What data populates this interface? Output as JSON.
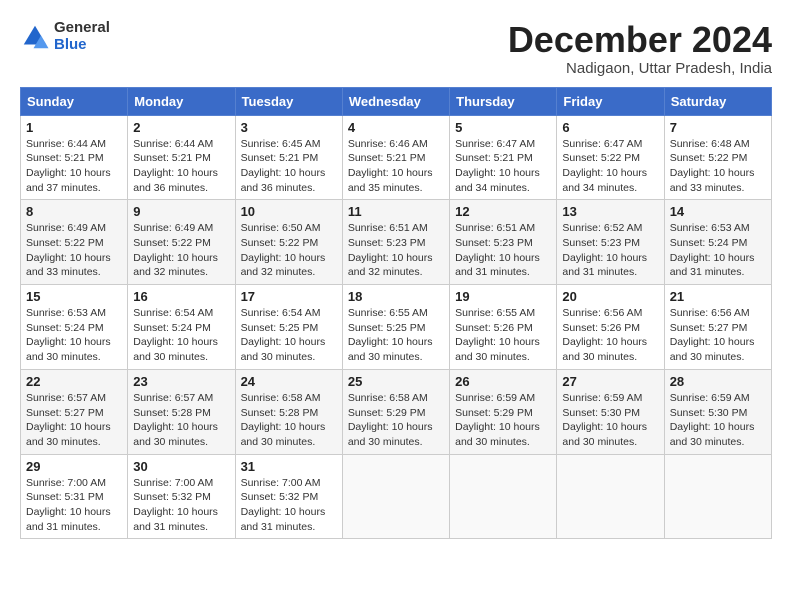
{
  "logo": {
    "general": "General",
    "blue": "Blue"
  },
  "title": "December 2024",
  "subtitle": "Nadigaon, Uttar Pradesh, India",
  "days_of_week": [
    "Sunday",
    "Monday",
    "Tuesday",
    "Wednesday",
    "Thursday",
    "Friday",
    "Saturday"
  ],
  "weeks": [
    [
      {
        "day": "1",
        "info": "Sunrise: 6:44 AM\nSunset: 5:21 PM\nDaylight: 10 hours\nand 37 minutes."
      },
      {
        "day": "2",
        "info": "Sunrise: 6:44 AM\nSunset: 5:21 PM\nDaylight: 10 hours\nand 36 minutes."
      },
      {
        "day": "3",
        "info": "Sunrise: 6:45 AM\nSunset: 5:21 PM\nDaylight: 10 hours\nand 36 minutes."
      },
      {
        "day": "4",
        "info": "Sunrise: 6:46 AM\nSunset: 5:21 PM\nDaylight: 10 hours\nand 35 minutes."
      },
      {
        "day": "5",
        "info": "Sunrise: 6:47 AM\nSunset: 5:21 PM\nDaylight: 10 hours\nand 34 minutes."
      },
      {
        "day": "6",
        "info": "Sunrise: 6:47 AM\nSunset: 5:22 PM\nDaylight: 10 hours\nand 34 minutes."
      },
      {
        "day": "7",
        "info": "Sunrise: 6:48 AM\nSunset: 5:22 PM\nDaylight: 10 hours\nand 33 minutes."
      }
    ],
    [
      {
        "day": "8",
        "info": "Sunrise: 6:49 AM\nSunset: 5:22 PM\nDaylight: 10 hours\nand 33 minutes."
      },
      {
        "day": "9",
        "info": "Sunrise: 6:49 AM\nSunset: 5:22 PM\nDaylight: 10 hours\nand 32 minutes."
      },
      {
        "day": "10",
        "info": "Sunrise: 6:50 AM\nSunset: 5:22 PM\nDaylight: 10 hours\nand 32 minutes."
      },
      {
        "day": "11",
        "info": "Sunrise: 6:51 AM\nSunset: 5:23 PM\nDaylight: 10 hours\nand 32 minutes."
      },
      {
        "day": "12",
        "info": "Sunrise: 6:51 AM\nSunset: 5:23 PM\nDaylight: 10 hours\nand 31 minutes."
      },
      {
        "day": "13",
        "info": "Sunrise: 6:52 AM\nSunset: 5:23 PM\nDaylight: 10 hours\nand 31 minutes."
      },
      {
        "day": "14",
        "info": "Sunrise: 6:53 AM\nSunset: 5:24 PM\nDaylight: 10 hours\nand 31 minutes."
      }
    ],
    [
      {
        "day": "15",
        "info": "Sunrise: 6:53 AM\nSunset: 5:24 PM\nDaylight: 10 hours\nand 30 minutes."
      },
      {
        "day": "16",
        "info": "Sunrise: 6:54 AM\nSunset: 5:24 PM\nDaylight: 10 hours\nand 30 minutes."
      },
      {
        "day": "17",
        "info": "Sunrise: 6:54 AM\nSunset: 5:25 PM\nDaylight: 10 hours\nand 30 minutes."
      },
      {
        "day": "18",
        "info": "Sunrise: 6:55 AM\nSunset: 5:25 PM\nDaylight: 10 hours\nand 30 minutes."
      },
      {
        "day": "19",
        "info": "Sunrise: 6:55 AM\nSunset: 5:26 PM\nDaylight: 10 hours\nand 30 minutes."
      },
      {
        "day": "20",
        "info": "Sunrise: 6:56 AM\nSunset: 5:26 PM\nDaylight: 10 hours\nand 30 minutes."
      },
      {
        "day": "21",
        "info": "Sunrise: 6:56 AM\nSunset: 5:27 PM\nDaylight: 10 hours\nand 30 minutes."
      }
    ],
    [
      {
        "day": "22",
        "info": "Sunrise: 6:57 AM\nSunset: 5:27 PM\nDaylight: 10 hours\nand 30 minutes."
      },
      {
        "day": "23",
        "info": "Sunrise: 6:57 AM\nSunset: 5:28 PM\nDaylight: 10 hours\nand 30 minutes."
      },
      {
        "day": "24",
        "info": "Sunrise: 6:58 AM\nSunset: 5:28 PM\nDaylight: 10 hours\nand 30 minutes."
      },
      {
        "day": "25",
        "info": "Sunrise: 6:58 AM\nSunset: 5:29 PM\nDaylight: 10 hours\nand 30 minutes."
      },
      {
        "day": "26",
        "info": "Sunrise: 6:59 AM\nSunset: 5:29 PM\nDaylight: 10 hours\nand 30 minutes."
      },
      {
        "day": "27",
        "info": "Sunrise: 6:59 AM\nSunset: 5:30 PM\nDaylight: 10 hours\nand 30 minutes."
      },
      {
        "day": "28",
        "info": "Sunrise: 6:59 AM\nSunset: 5:30 PM\nDaylight: 10 hours\nand 30 minutes."
      }
    ],
    [
      {
        "day": "29",
        "info": "Sunrise: 7:00 AM\nSunset: 5:31 PM\nDaylight: 10 hours\nand 31 minutes."
      },
      {
        "day": "30",
        "info": "Sunrise: 7:00 AM\nSunset: 5:32 PM\nDaylight: 10 hours\nand 31 minutes."
      },
      {
        "day": "31",
        "info": "Sunrise: 7:00 AM\nSunset: 5:32 PM\nDaylight: 10 hours\nand 31 minutes."
      },
      {
        "day": "",
        "info": ""
      },
      {
        "day": "",
        "info": ""
      },
      {
        "day": "",
        "info": ""
      },
      {
        "day": "",
        "info": ""
      }
    ]
  ]
}
